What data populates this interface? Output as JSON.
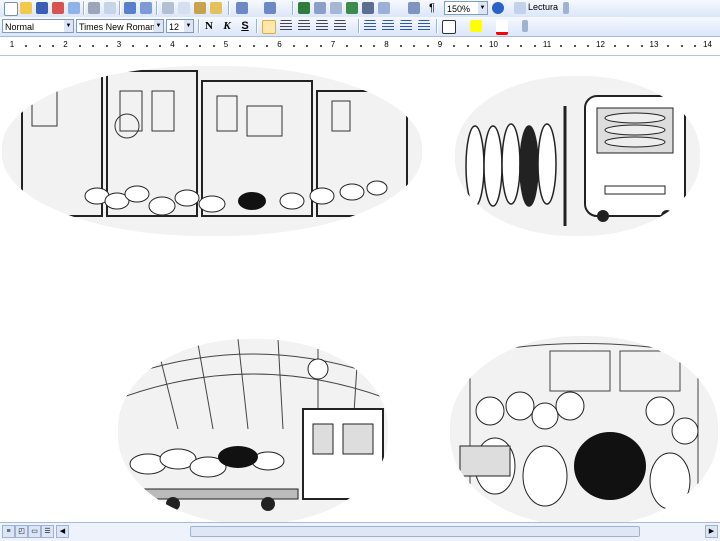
{
  "toolbar_standard": {
    "zoom": "150%",
    "reading_label": "Lectura"
  },
  "toolbar_formatting": {
    "style": "Normal",
    "font": "Times New Roman",
    "font_size": "12",
    "bold_label": "N",
    "italic_label": "K",
    "underline_label": "S"
  },
  "ruler": {
    "numbers": [
      "1",
      "2",
      "3",
      "4",
      "5",
      "6",
      "7",
      "8",
      "9",
      "10",
      "11",
      "12",
      "13",
      "14"
    ]
  },
  "colors": {
    "toolbar_top": "#f6f9ff",
    "toolbar_bottom": "#dbe6f8",
    "text_color_swatch": "#ff0000",
    "highlight_swatch": "#ffff00"
  }
}
